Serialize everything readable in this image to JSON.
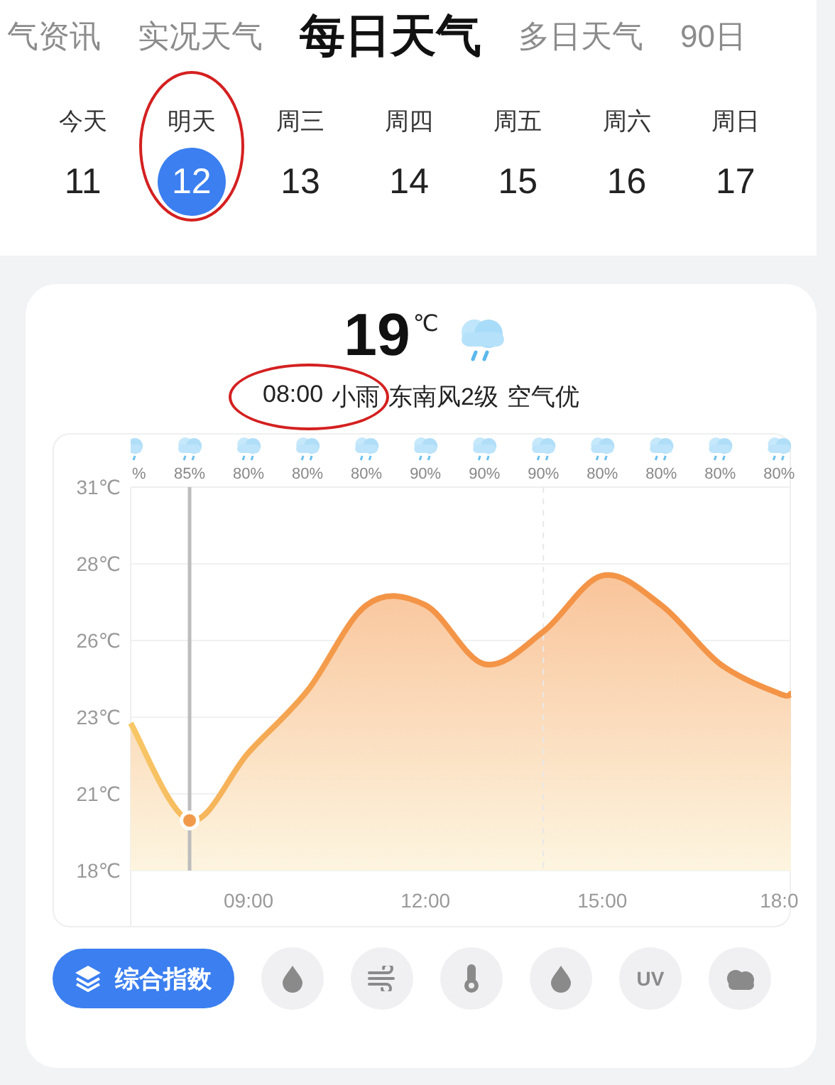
{
  "tabs": [
    {
      "label": "气资讯",
      "selected": false
    },
    {
      "label": "实况天气",
      "selected": false
    },
    {
      "label": "每日天气",
      "selected": true
    },
    {
      "label": "多日天气",
      "selected": false
    },
    {
      "label": "90日",
      "selected": false
    }
  ],
  "days": [
    {
      "weekday": "今天",
      "date": "11",
      "selected": false,
      "circled": false
    },
    {
      "weekday": "明天",
      "date": "12",
      "selected": true,
      "circled": true
    },
    {
      "weekday": "周三",
      "date": "13",
      "selected": false,
      "circled": false
    },
    {
      "weekday": "周四",
      "date": "14",
      "selected": false,
      "circled": false
    },
    {
      "weekday": "周五",
      "date": "15",
      "selected": false,
      "circled": false
    },
    {
      "weekday": "周六",
      "date": "16",
      "selected": false,
      "circled": false
    },
    {
      "weekday": "周日",
      "date": "17",
      "selected": false,
      "circled": false
    }
  ],
  "current": {
    "temperature": "19",
    "unit": "℃",
    "time": "08:00",
    "condition": "小雨",
    "circled": true,
    "wind": "东南风2级",
    "air": "空气优"
  },
  "hourly_rain": [
    "%",
    "85%",
    "80%",
    "80%",
    "80%",
    "90%",
    "90%",
    "90%",
    "80%",
    "80%",
    "80%",
    "80%"
  ],
  "chart": {
    "chart_data": {
      "type": "area",
      "x": [
        7,
        8,
        9,
        10,
        11,
        12,
        13,
        14,
        15,
        16,
        17,
        18,
        18.2
      ],
      "grid": true,
      "series": [
        {
          "color": "#f39447",
          "values": [
            23,
            19.7,
            22,
            24.1,
            27,
            27,
            25,
            26.1,
            28,
            27,
            25,
            24,
            24
          ]
        }
      ],
      "xlim": [
        7,
        18.2
      ],
      "ylim": [
        18,
        31
      ],
      "xticks": [
        {
          "value": 9,
          "label": "09:00"
        },
        {
          "value": 12,
          "label": "12:00"
        },
        {
          "value": 15,
          "label": "15:00"
        },
        {
          "value": 18,
          "label": "18:0"
        }
      ],
      "yticks": [
        {
          "value": 31,
          "label": "31℃"
        },
        {
          "value": 28.4,
          "label": "28℃"
        },
        {
          "value": 25.8,
          "label": "26℃"
        },
        {
          "value": 23.2,
          "label": "23℃"
        },
        {
          "value": 20.6,
          "label": "21℃"
        },
        {
          "value": 18,
          "label": "18℃"
        }
      ],
      "ref_lines": [
        {
          "axis": "x",
          "value": 8
        },
        {
          "axis": "x",
          "value": 14
        }
      ]
    }
  },
  "index_button": {
    "label": "综合指数"
  },
  "index_items": [
    {
      "kind": "drop"
    },
    {
      "kind": "wind"
    },
    {
      "kind": "thermometer"
    },
    {
      "kind": "drop"
    },
    {
      "kind": "uv",
      "label": "UV"
    },
    {
      "kind": "cloud"
    }
  ]
}
